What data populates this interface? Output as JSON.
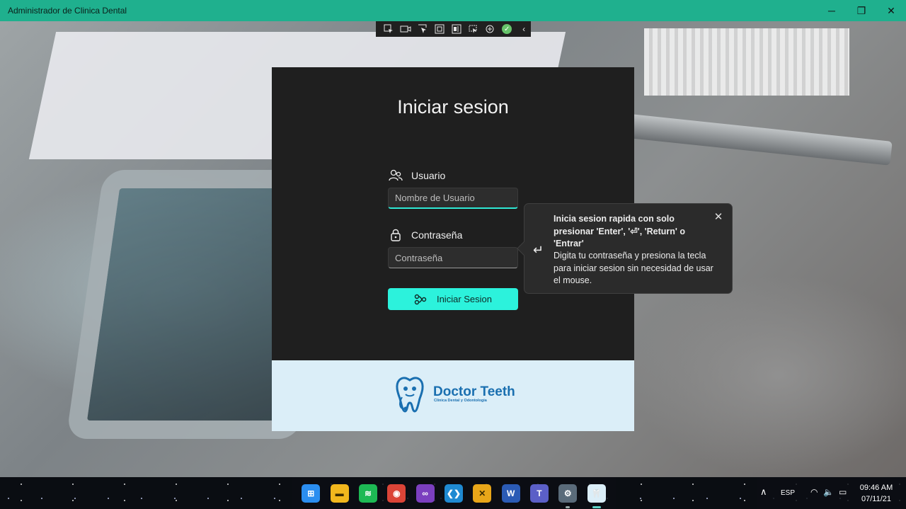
{
  "window": {
    "title": "Administrador de Clinica Dental",
    "minimize_glyph": "─",
    "maximize_glyph": "❐",
    "close_glyph": "✕"
  },
  "devbar": {
    "icons": [
      "select-element-icon",
      "record-icon",
      "pointer-icon",
      "frame-icon",
      "layout-icon",
      "track-focus-icon",
      "binding-icon",
      "check-icon",
      "collapse-icon"
    ],
    "check_glyph": "✓",
    "collapse_glyph": "‹"
  },
  "login": {
    "title": "Iniciar sesion",
    "user_label": "Usuario",
    "user_placeholder": "Nombre de Usuario",
    "password_label": "Contraseña",
    "password_placeholder": "Contraseña",
    "submit_label": "Iniciar Sesion"
  },
  "logo": {
    "name": "Doctor Teeth",
    "tagline": "Clinica Dental y Odontologia"
  },
  "tip": {
    "title": "Inicia sesion rapida con solo presionar 'Enter', '⏎', 'Return' o 'Entrar'",
    "body": "Digita tu contraseña y presiona la tecla para iniciar sesion sin necesidad de usar el mouse.",
    "return_glyph": "↵",
    "close_glyph": "✕"
  },
  "taskbar": {
    "apps": [
      {
        "name": "start-button",
        "glyph": "⊞",
        "color": "#2b8ef0"
      },
      {
        "name": "file-explorer",
        "glyph": "▬",
        "color": "#f2b71d"
      },
      {
        "name": "spotify",
        "glyph": "≋",
        "color": "#1db954"
      },
      {
        "name": "chrome",
        "glyph": "◉",
        "color": "#db4437"
      },
      {
        "name": "visual-studio",
        "glyph": "∞",
        "color": "#7b3fbf"
      },
      {
        "name": "vs-code",
        "glyph": "❮❯",
        "color": "#1f8ad2"
      },
      {
        "name": "xaml-tool",
        "glyph": "✕",
        "color": "#e8a619"
      },
      {
        "name": "word",
        "glyph": "W",
        "color": "#2b5bb5"
      },
      {
        "name": "teams",
        "glyph": "T",
        "color": "#5b5fc7"
      },
      {
        "name": "settings",
        "glyph": "⚙",
        "color": "#5a6b7a"
      },
      {
        "name": "dental-app",
        "glyph": "🦷",
        "color": "#dbeef8"
      }
    ],
    "tray": {
      "chevron": "∧",
      "language": "ESP",
      "wifi_glyph": "◠",
      "volume_glyph": "🔈",
      "battery_glyph": "▭",
      "time": "09:46 AM",
      "date": "07/11/21"
    }
  }
}
